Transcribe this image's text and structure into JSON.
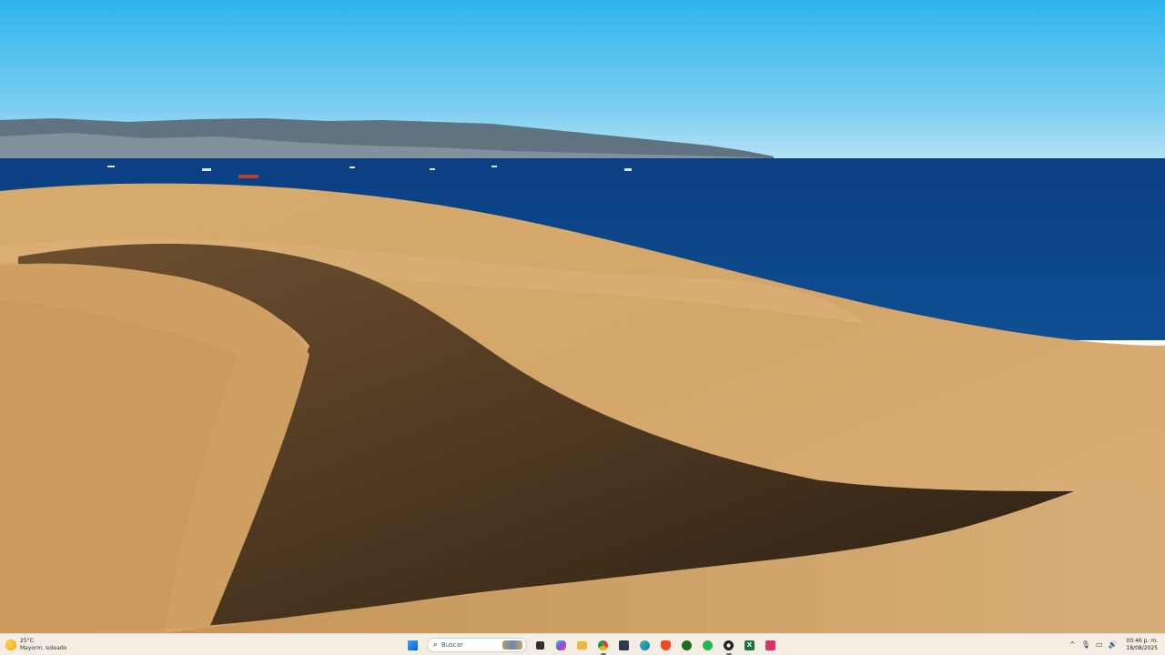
{
  "taskbar": {
    "weather": {
      "temp": "25°C",
      "desc": "Mayorm. soleado",
      "icon": "sun-icon"
    },
    "search": {
      "label": "Buscar",
      "icon": "search-icon"
    },
    "apps": [
      {
        "name": "windows-start-icon",
        "color": "#1a73d8",
        "symbol": ""
      },
      {
        "name": "search-icon",
        "color": "",
        "symbol": ""
      },
      {
        "name": "task-view-icon",
        "color": "#333333",
        "symbol": ""
      },
      {
        "name": "copilot-icon",
        "color": "#7b4dd6",
        "symbol": ""
      },
      {
        "name": "file-explorer-icon",
        "color": "#f2b630",
        "symbol": ""
      },
      {
        "name": "chrome-icon",
        "color": "#d93f34",
        "symbol": ""
      },
      {
        "name": "calculator-icon",
        "color": "#3d4a5c",
        "symbol": ""
      },
      {
        "name": "edge-icon",
        "color": "#2c7ad6",
        "symbol": ""
      },
      {
        "name": "brave-icon",
        "color": "#e8452c",
        "symbol": ""
      },
      {
        "name": "xbox-icon",
        "color": "#1f7a1f",
        "symbol": ""
      },
      {
        "name": "spotify-icon",
        "color": "#1db954",
        "symbol": ""
      },
      {
        "name": "obs-icon",
        "color": "#2b2b2b",
        "symbol": ""
      },
      {
        "name": "excel-icon",
        "color": "#1e7145",
        "symbol": ""
      },
      {
        "name": "snipping-tool-icon",
        "color": "#d6336c",
        "symbol": ""
      }
    ],
    "tray": {
      "chevron": "^",
      "clock_time": "03:46 p. m.",
      "clock_date": "18/08/2025"
    }
  }
}
